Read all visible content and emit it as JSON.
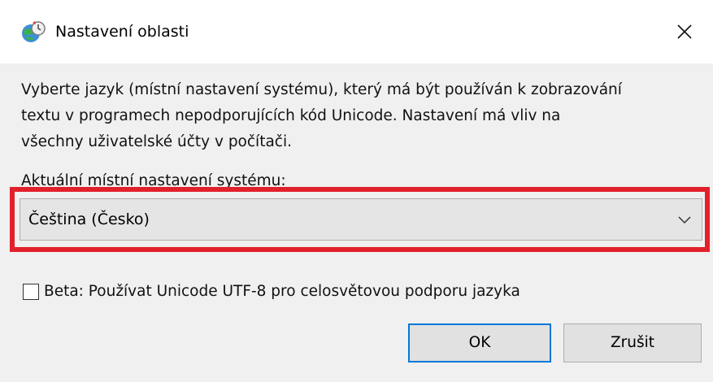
{
  "window": {
    "title": "Nastavení oblasti",
    "title_icon": "globe-clock-icon",
    "close_icon": "close-icon"
  },
  "content": {
    "description_lines": [
      "Vyberte jazyk (místní nastavení systému), který má být používán k zobrazování",
      "textu v programech nepodporujících kód Unicode. Nastavení má vliv na",
      "všechny uživatelské účty v počítači."
    ],
    "locale_label": "Aktuální místní nastavení systému:",
    "locale_selected": "Čeština (Česko)",
    "beta_label": "Beta: Používat Unicode UTF-8 pro celosvětovou podporu jazyka",
    "beta_checked": false
  },
  "buttons": {
    "ok_label": "OK",
    "cancel_label": "Zrušit"
  },
  "colors": {
    "highlight": "#e2202b",
    "ok_border": "#0078d7",
    "dialog_bg": "#f0f0f0"
  }
}
